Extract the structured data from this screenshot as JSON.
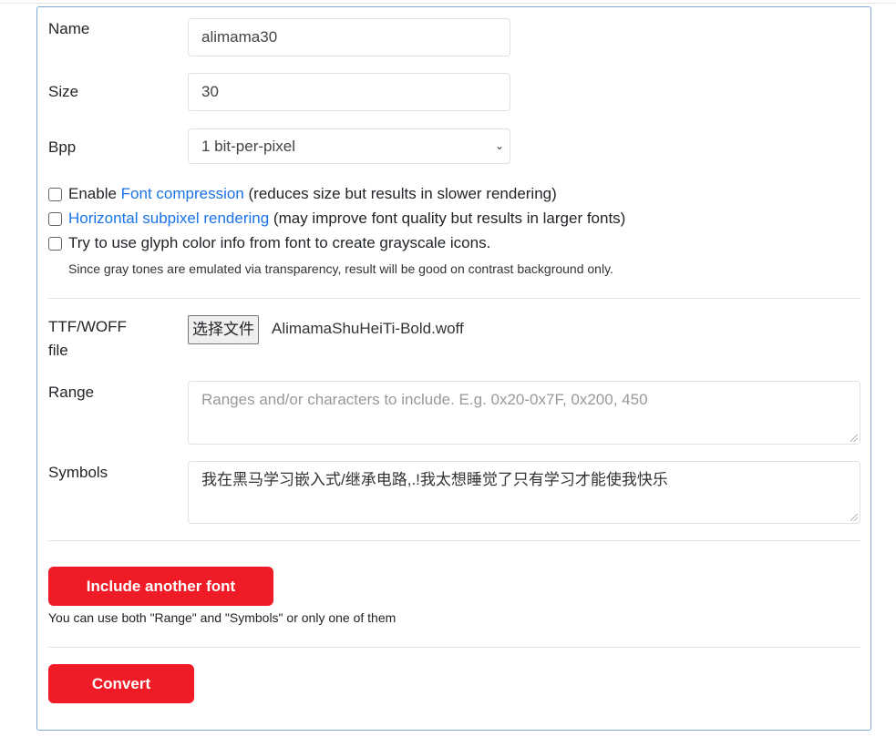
{
  "form": {
    "name_label": "Name",
    "name_value": "alimama30",
    "size_label": "Size",
    "size_value": "30",
    "bpp_label": "Bpp",
    "bpp_value": "1 bit-per-pixel",
    "compression_pre": "Enable ",
    "compression_link": "Font compression",
    "compression_post": " (reduces size but results in slower rendering)",
    "subpixel_link": "Horizontal subpixel rendering",
    "subpixel_post": " (may improve font quality but results in larger fonts)",
    "glyph_color_label": "Try to use glyph color info from font to create grayscale icons.",
    "glyph_color_hint": "Since gray tones are emulated via transparency, result will be good on contrast background only.",
    "file_label_line1": "TTF/WOFF",
    "file_label_line2": "file",
    "file_button": "选择文件",
    "file_name": "AlimamaShuHeiTi-Bold.woff",
    "range_label": "Range",
    "range_placeholder": "Ranges and/or characters to include. E.g. 0x20-0x7F, 0x200, 450",
    "range_value": "",
    "symbols_label": "Symbols",
    "symbols_value": "我在黑马学习嵌入式/继承电路,.!我太想睡觉了只有学习才能使我快乐",
    "include_button": "Include another font",
    "include_hint": "You can use both \"Range\" and \"Symbols\" or only one of them",
    "convert_button": "Convert"
  },
  "colors": {
    "accent": "#ef1c27",
    "link": "#1a73e8",
    "card_border": "#7ea9d8"
  }
}
